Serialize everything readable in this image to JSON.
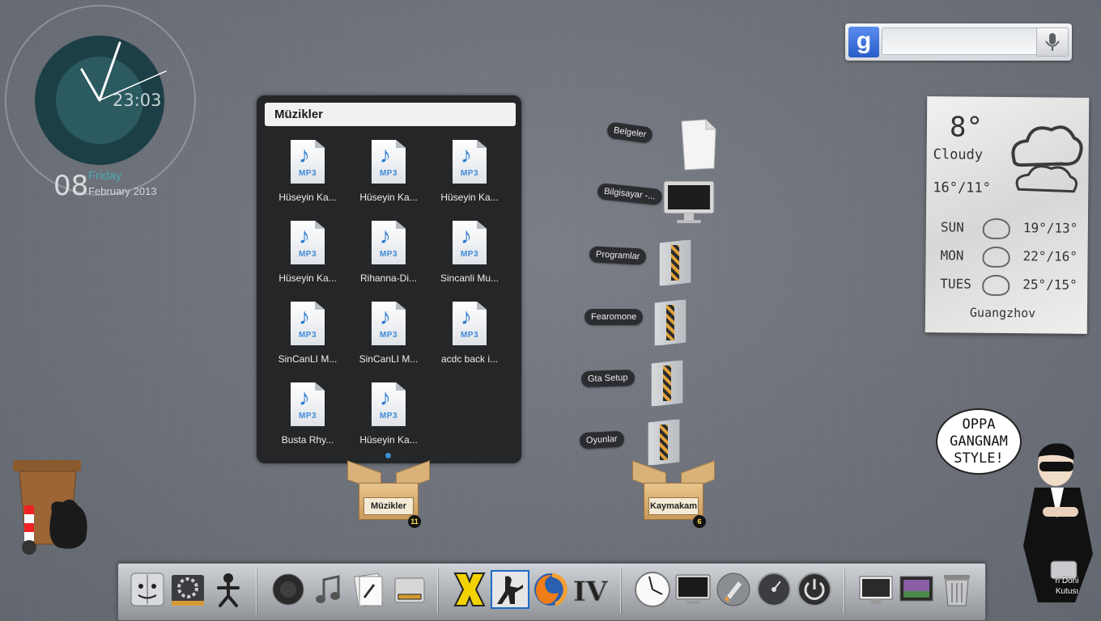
{
  "clock": {
    "time": "23:03",
    "day": "08",
    "weekday": "Friday",
    "month_year": "February 2013"
  },
  "search": {
    "logo": "g",
    "placeholder": ""
  },
  "stack": {
    "title": "Müzikler",
    "files": [
      {
        "name": "Hüseyin Ka...",
        "type": "MP3"
      },
      {
        "name": "Hüseyin Ka...",
        "type": "MP3"
      },
      {
        "name": "Hüseyin Ka...",
        "type": "MP3"
      },
      {
        "name": "Hüseyin Ka...",
        "type": "MP3"
      },
      {
        "name": "Rihanna-Di...",
        "type": "MP3"
      },
      {
        "name": "Sincanli Mu...",
        "type": "MP3"
      },
      {
        "name": "SinCanLI M...",
        "type": "MP3"
      },
      {
        "name": "SinCanLI M...",
        "type": "MP3"
      },
      {
        "name": "acdc back i...",
        "type": "MP3"
      },
      {
        "name": "Busta Rhy...",
        "type": "MP3"
      },
      {
        "name": "Hüseyin Ka...",
        "type": "MP3"
      }
    ]
  },
  "boxes": {
    "muzikler": {
      "label": "Müzikler",
      "count": "11"
    },
    "kaymakam": {
      "label": "Kaymakam",
      "count": "6"
    }
  },
  "fan": {
    "items": [
      {
        "label": "Belgeler",
        "icon": "document-icon"
      },
      {
        "label": "Bilgisayar -...",
        "icon": "monitor-icon"
      },
      {
        "label": "Programlar",
        "icon": "folder-icon"
      },
      {
        "label": "Fearomone",
        "icon": "folder-icon"
      },
      {
        "label": "Gta Setup",
        "icon": "folder-icon"
      },
      {
        "label": "Oyunlar",
        "icon": "folder-icon"
      }
    ]
  },
  "weather": {
    "temp": "8°",
    "condition": "Cloudy",
    "hilo": "16°/11°",
    "forecast": [
      {
        "day": "SUN",
        "range": "19°/13°"
      },
      {
        "day": "MON",
        "range": "22°/16°"
      },
      {
        "day": "TUES",
        "range": "25°/15°"
      }
    ],
    "city": "Guangzhov"
  },
  "bubble": {
    "line1": "OPPA",
    "line2": "GANGNAM",
    "line3": "STYLE!"
  },
  "recycle": {
    "line1": "ri Döni",
    "line2": "Kutusı"
  },
  "dock": {
    "items": [
      "finder-icon",
      "system-preferences-icon",
      "stickman-icon",
      "quicktime-icon",
      "itunes-icon",
      "preview-icon",
      "disk-utility-icon",
      "xfire-icon",
      "counter-strike-icon",
      "firefox-icon",
      "gta-iv-icon",
      "clock-icon",
      "display-icon",
      "launchpad-icon",
      "dashboard-icon",
      "power-icon",
      "desktop-icon",
      "photo-icon",
      "trash-icon"
    ]
  },
  "colors": {
    "accent": "#4ca6b2",
    "background": "#6c7078",
    "badge": "#ffe14a"
  }
}
